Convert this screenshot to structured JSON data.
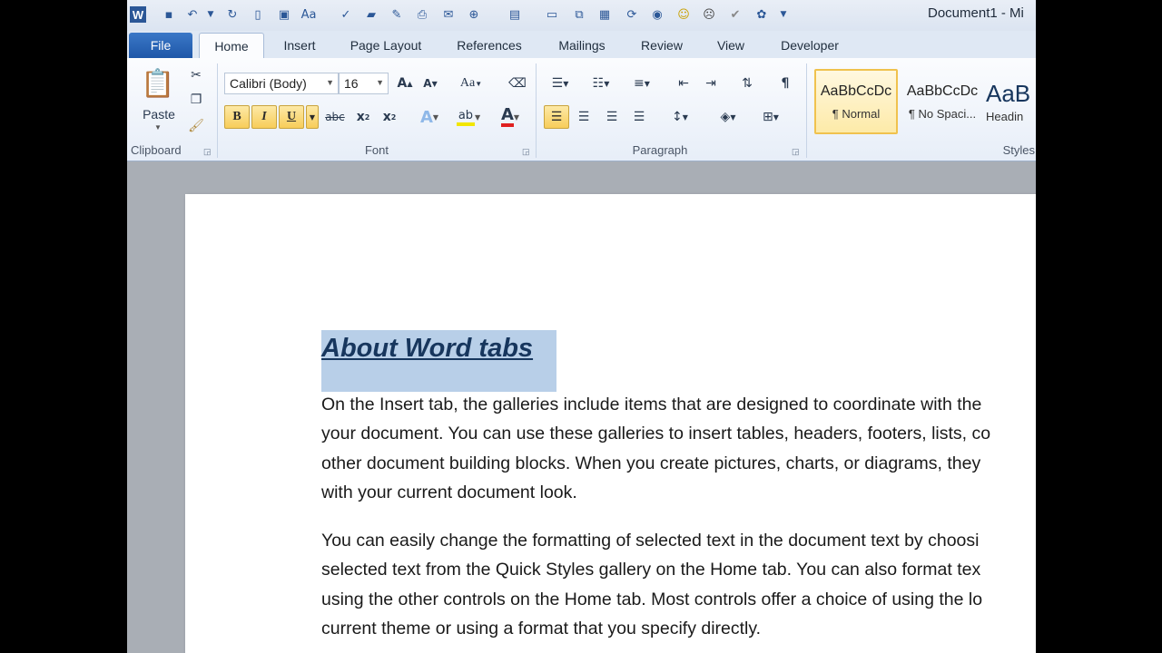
{
  "title_bar": {
    "document_title": "Document1  -  Mi"
  },
  "tabs": [
    "File",
    "Home",
    "Insert",
    "Page Layout",
    "References",
    "Mailings",
    "Review",
    "View",
    "Developer"
  ],
  "clipboard": {
    "paste_label": "Paste",
    "group_label": "Clipboard"
  },
  "font": {
    "name": "Calibri (Body)",
    "size": "16",
    "change_case": "Aa",
    "group_label": "Font"
  },
  "paragraph": {
    "group_label": "Paragraph"
  },
  "styles": {
    "group_label": "Styles",
    "items": [
      {
        "sample": "AaBbCcDc",
        "name": "¶ Normal"
      },
      {
        "sample": "AaBbCcDc",
        "name": "¶ No Spaci..."
      },
      {
        "sample": "AaB",
        "name": "Headin"
      }
    ]
  },
  "document": {
    "heading": "About Word tabs",
    "paragraph1": [
      "On the Insert tab, the galleries include items that are designed to coordinate with the",
      "your document. You can use these galleries to insert tables, headers, footers, lists, co",
      "other document building  blocks. When you create pictures, charts, or diagrams, they",
      "with your current document look."
    ],
    "paragraph2": [
      "You can easily change the formatting of selected text in the document text by choosi",
      "selected text from the Quick Styles gallery on the Home tab. You can also format tex",
      "using the other controls on the Home tab. Most controls offer a choice of using the lo",
      "current theme or using a format that you specify directly."
    ]
  },
  "colors": {
    "highlight": "#f2e600",
    "font_color": "#e02020",
    "selection": "#b8cfe8",
    "heading_text": "#17365d"
  }
}
